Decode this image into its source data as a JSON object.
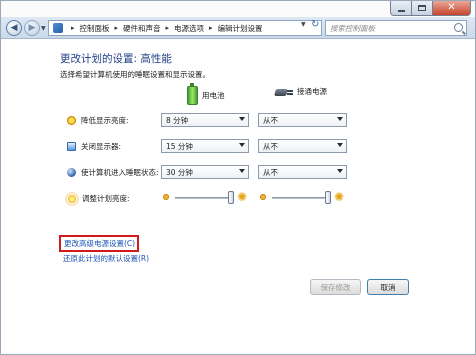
{
  "titlebar": {
    "minimize_icon": "minimize-icon",
    "maximize_icon": "maximize-icon",
    "close_icon": "close-icon",
    "close_glyph": "✕"
  },
  "navigation": {
    "back_glyph": "◀",
    "forward_glyph": "▶",
    "breadcrumb": [
      "控制面板",
      "硬件和声音",
      "电源选项",
      "编辑计划设置"
    ],
    "separator": "▸",
    "refresh_glyph": "↻",
    "search_placeholder": "搜索控制面板"
  },
  "page": {
    "title": "更改计划的设置: 高性能",
    "subtitle": "选择希望计算机使用的睡眠设置和显示设置。",
    "columns": {
      "battery": "用电池",
      "plugged_in": "接通电源"
    }
  },
  "settings": [
    {
      "label": "降低显示亮度:",
      "icon": "dim-display-icon",
      "battery": "8 分钟",
      "plugged_in": "从不"
    },
    {
      "label": "关闭显示器:",
      "icon": "display-icon",
      "battery": "15 分钟",
      "plugged_in": "从不"
    },
    {
      "label": "使计算机进入睡眠状态:",
      "icon": "sleep-icon",
      "battery": "30 分钟",
      "plugged_in": "从不"
    }
  ],
  "brightness": {
    "label": "调整计划亮度:",
    "icon": "brightness-icon",
    "battery_level": 1.0,
    "plugged_in_level": 1.0,
    "sun_glyph": "✺"
  },
  "links": {
    "advanced": "更改高级电源设置(C)",
    "restore": "还原此计划的默认设置(R)"
  },
  "buttons": {
    "save": "保存修改",
    "cancel": "取消"
  },
  "colors": {
    "title": "#1f3f86",
    "link": "#1c54b8",
    "highlight_box": "#d11b1b"
  }
}
